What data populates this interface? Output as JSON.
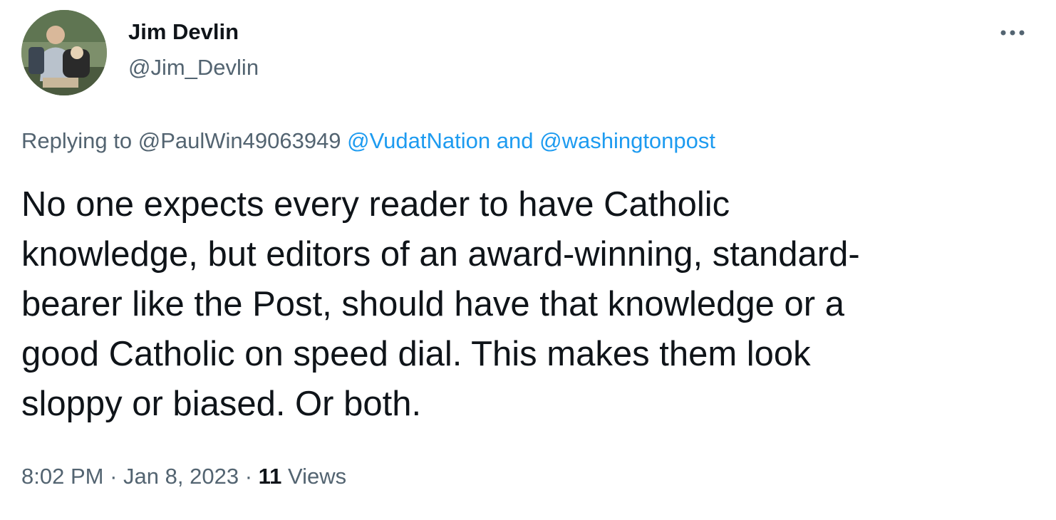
{
  "author": {
    "display_name": "Jim Devlin",
    "handle": "@Jim_Devlin",
    "avatar_icon": "profile-photo"
  },
  "actions": {
    "more_icon": "more-horizontal-icon"
  },
  "reply": {
    "prefix": "Replying to",
    "first_mention": "@PaulWin49063949",
    "second_mention": "@VudatNation",
    "conjunction": "and",
    "third_mention": "@washingtonpost"
  },
  "tweet": {
    "text": "No one expects every reader to have  Catholic\nknowledge, but editors of an award-winning, standard-\nbearer like the Post, should have that knowledge or a\ngood Catholic on speed dial. This makes them look\nsloppy or biased. Or both."
  },
  "meta": {
    "time": "8:02 PM",
    "date": "Jan 8, 2023",
    "separator": "·",
    "views_count": "11",
    "views_label": "Views"
  },
  "colors": {
    "text_primary": "#0f1419",
    "text_secondary": "#536471",
    "link": "#1d9bf0"
  }
}
